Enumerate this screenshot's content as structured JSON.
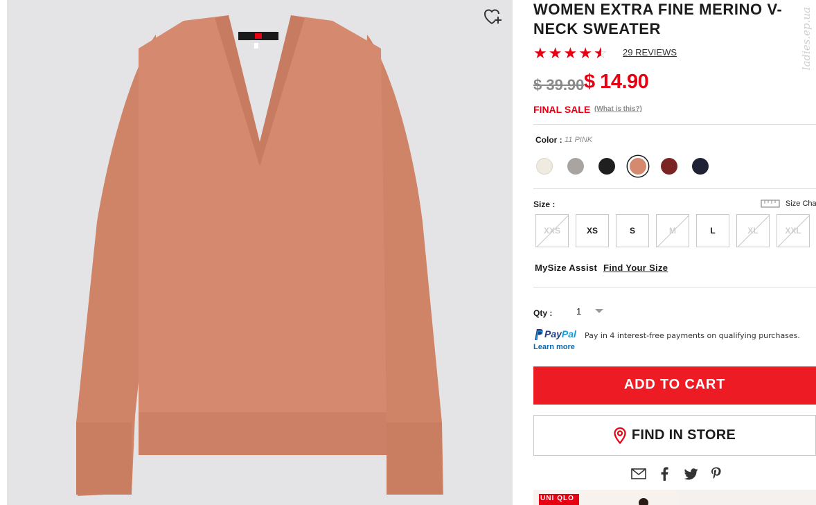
{
  "product": {
    "title": "WOMEN EXTRA FINE MERINO V-NECK SWEATER",
    "rating": 4.5,
    "reviews_label": "29 REVIEWS",
    "original_price": "$ 39.90",
    "sale_price": "$ 14.90",
    "final_sale_label": "FINAL SALE",
    "what_is_this_label": "(What is this?)"
  },
  "watermark": "ladies.ep.ua",
  "image": {
    "garment_color": "#d5896f",
    "background_color": "#e4e4e6",
    "wishlist_icon": "heart-plus-icon"
  },
  "color": {
    "label": "Color :",
    "selected_value": "11 PINK",
    "swatches": [
      {
        "name": "off-white",
        "hex": "#f0ebe0"
      },
      {
        "name": "gray",
        "hex": "#a7a4a1"
      },
      {
        "name": "black",
        "hex": "#1f1f1f"
      },
      {
        "name": "pink",
        "hex": "#d5896f",
        "selected": true
      },
      {
        "name": "wine",
        "hex": "#7a2424"
      },
      {
        "name": "navy",
        "hex": "#1f2235"
      }
    ]
  },
  "size": {
    "label": "Size :",
    "chart_label": "Size Cha",
    "options": [
      {
        "label": "XXS",
        "available": false
      },
      {
        "label": "XS",
        "available": true
      },
      {
        "label": "S",
        "available": true
      },
      {
        "label": "M",
        "available": false
      },
      {
        "label": "L",
        "available": true
      },
      {
        "label": "XL",
        "available": false
      },
      {
        "label": "XXL",
        "available": false
      }
    ]
  },
  "mysize": {
    "label": "MySize Assist",
    "link": "Find Your Size"
  },
  "qty": {
    "label": "Qty :",
    "value": "1"
  },
  "paypal": {
    "brand_p": "Pay",
    "brand_pal": "Pal",
    "text": "Pay in 4 interest-free payments on qualifying purchases.",
    "learn_more": "Learn more"
  },
  "actions": {
    "add_to_cart": "ADD TO CART",
    "find_in_store": "FIND IN STORE"
  },
  "share_icons": [
    "email-icon",
    "facebook-icon",
    "twitter-icon",
    "pinterest-icon"
  ],
  "banner": {
    "logo_top": "UNI",
    "logo_bottom": "QLO"
  },
  "colors": {
    "accent_red": "#e60012",
    "button_red": "#ed1c24",
    "paypal_blue": "#0f6aad"
  }
}
